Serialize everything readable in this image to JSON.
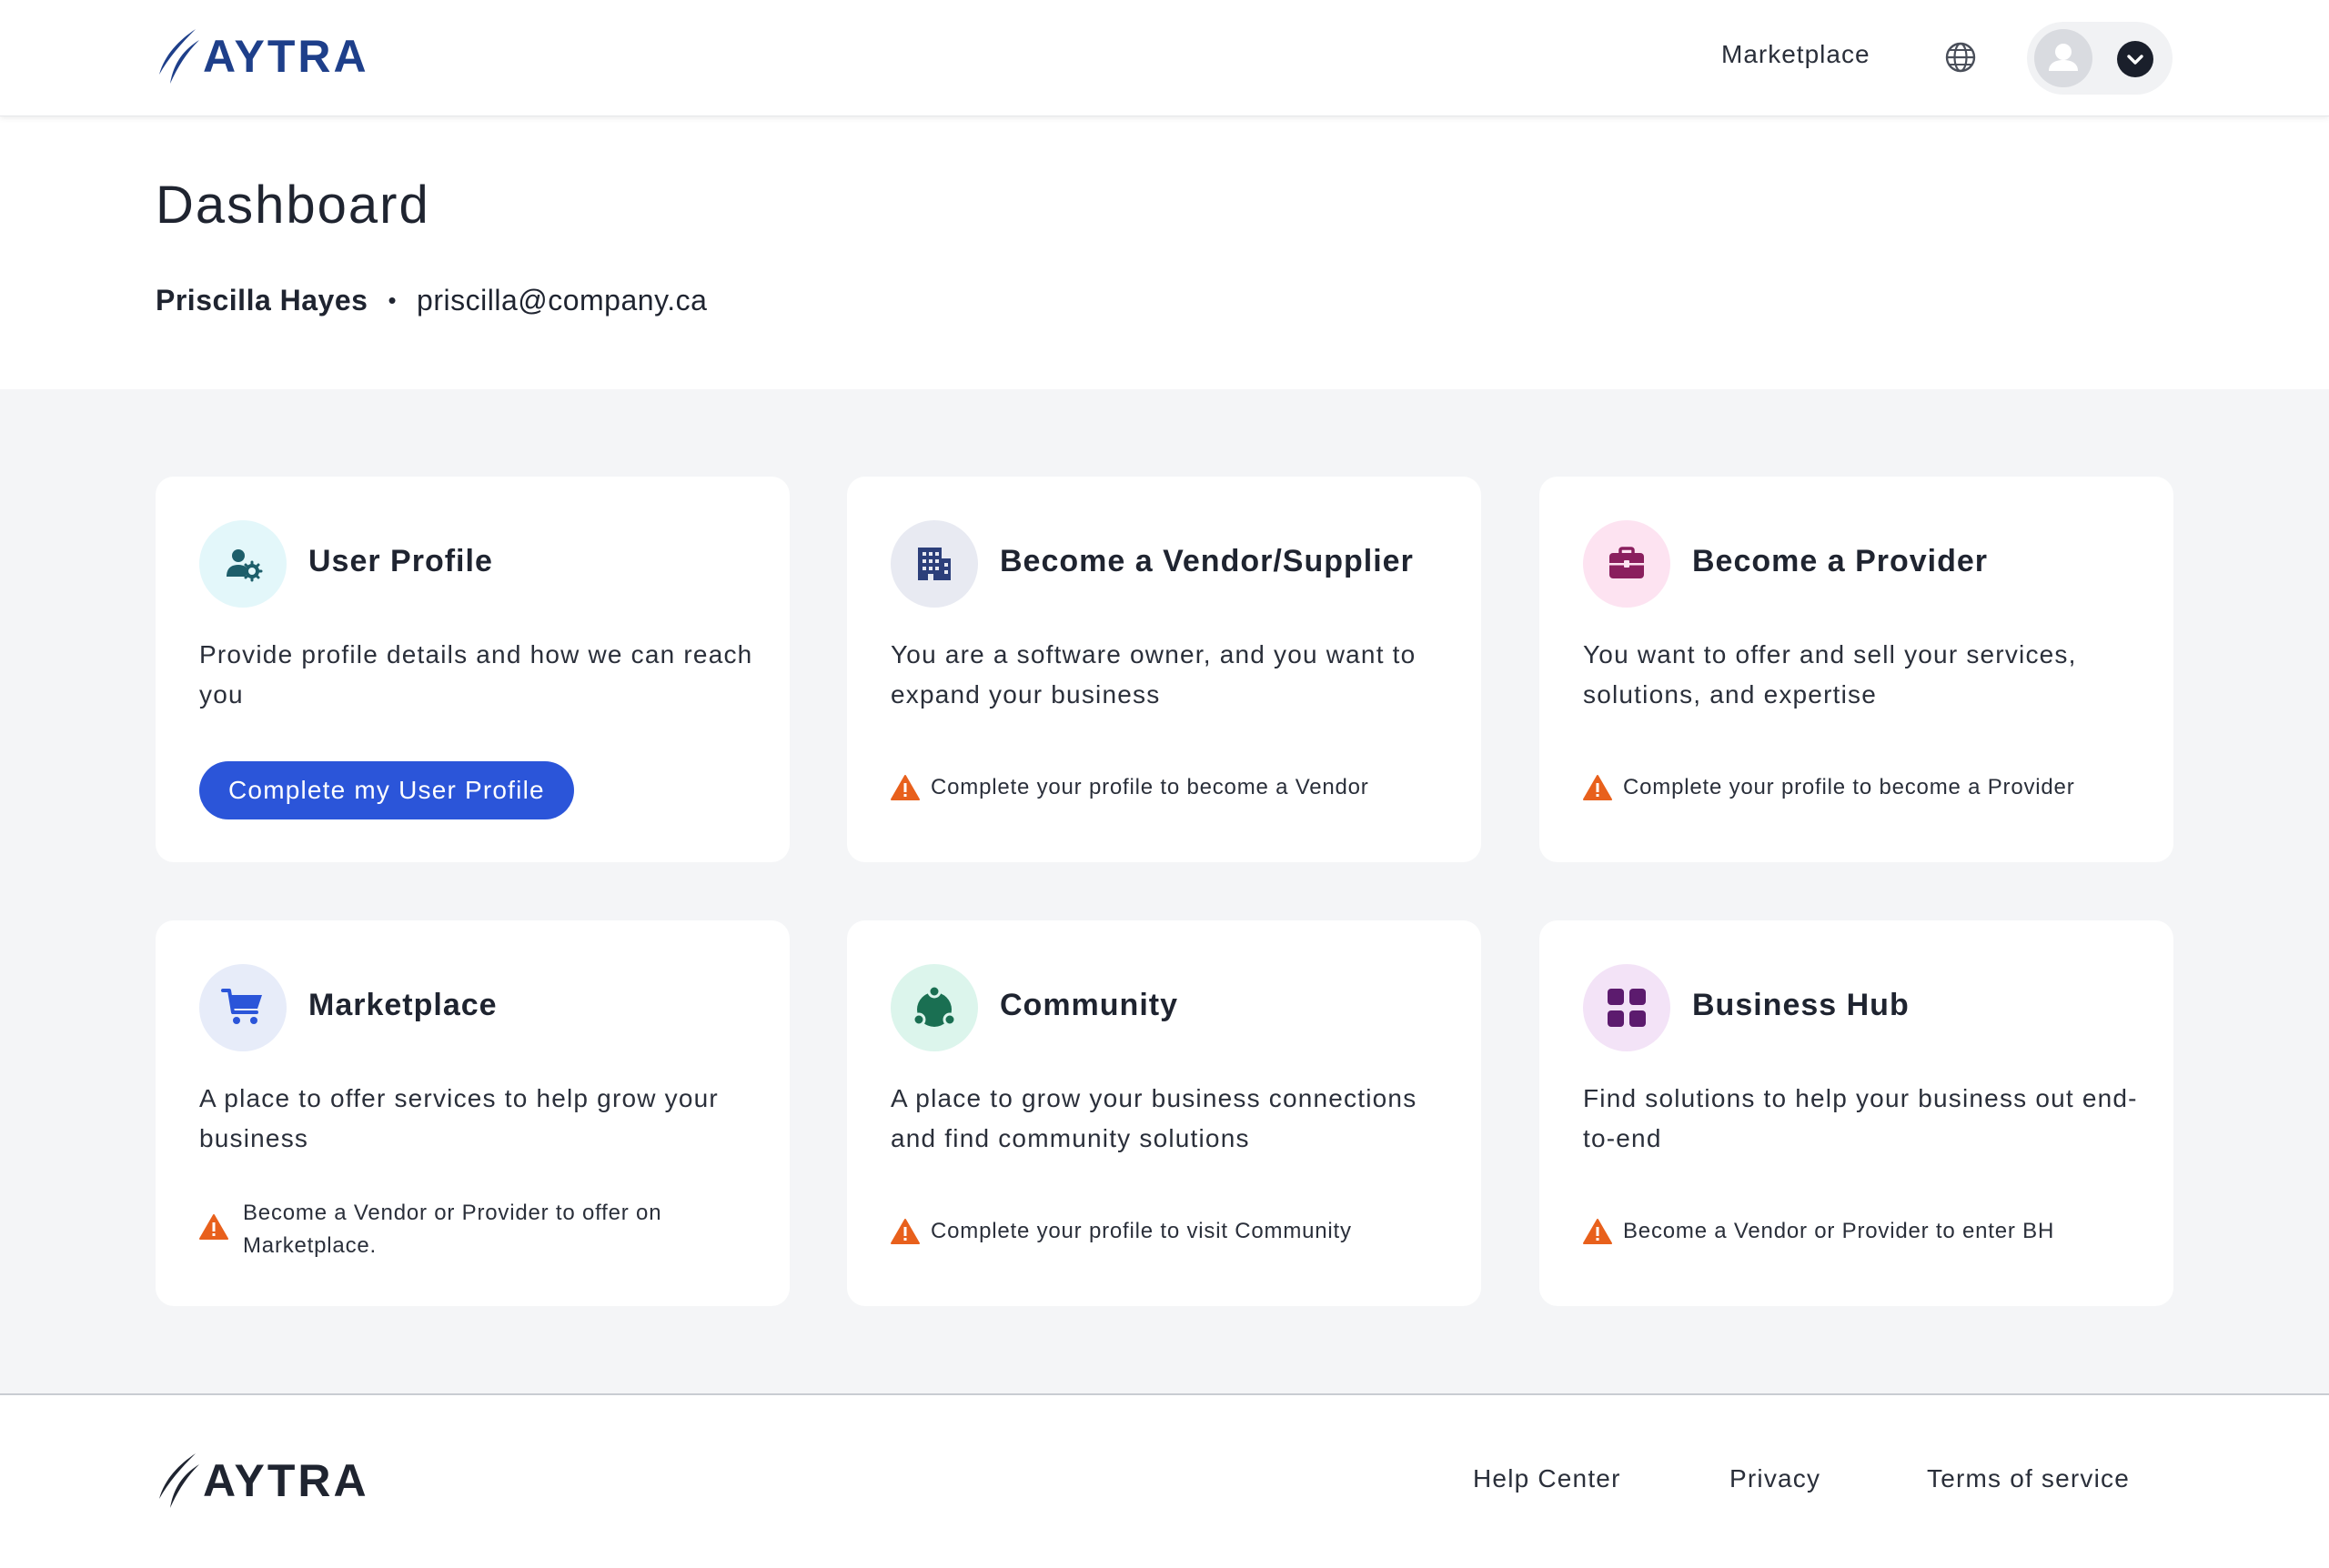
{
  "header": {
    "logo_text": "AYTRA",
    "nav_link": "Marketplace",
    "icons": {
      "language": "globe-icon",
      "avatar": "user-avatar-icon",
      "menu": "chevron-down-icon"
    }
  },
  "page": {
    "title": "Dashboard",
    "user_name": "Priscilla Hayes",
    "separator": "•",
    "user_email": "priscilla@company.ca"
  },
  "cards": [
    {
      "title": "User Profile",
      "description": "Provide profile details and how we can reach you",
      "button_label": "Complete my User Profile",
      "icon": "user-settings-icon",
      "icon_bg": "#e3f7fa",
      "icon_color": "#1d5e6a"
    },
    {
      "title": "Become a Vendor/Supplier",
      "description": "You are a software owner, and you want to expand your business",
      "note": "Complete your profile to become a Vendor",
      "icon": "building-icon",
      "icon_bg": "#e8eaf2",
      "icon_color": "#2c3f7a"
    },
    {
      "title": "Become a Provider",
      "description": "You want to offer and sell your services, solutions, and expertise",
      "note": "Complete your profile to become a Provider",
      "icon": "briefcase-icon",
      "icon_bg": "#fde3f1",
      "icon_color": "#8a1f5e"
    },
    {
      "title": "Marketplace",
      "description": "A place to offer services to help grow your business",
      "note": "Become a Vendor or Provider to offer on Marketplace.",
      "icon": "shopping-cart-icon",
      "icon_bg": "#e7ecf9",
      "icon_color": "#2b55d9"
    },
    {
      "title": "Community",
      "description": "A place to grow your business connections and find community solutions",
      "note": "Complete your profile to visit Community",
      "icon": "community-icon",
      "icon_bg": "#dcf5ec",
      "icon_color": "#1a6f52"
    },
    {
      "title": "Business Hub",
      "description": "Find solutions to help your business out end-to-end",
      "note": "Become a Vendor or Provider to enter BH",
      "icon": "grid-icon",
      "icon_bg": "#f3e3f7",
      "icon_color": "#5c1b6e"
    }
  ],
  "warning_color": "#e8601c",
  "primary_color": "#2b55d9",
  "footer": {
    "logo_text": "AYTRA",
    "links": [
      "Help Center",
      "Privacy",
      "Terms of service"
    ]
  }
}
